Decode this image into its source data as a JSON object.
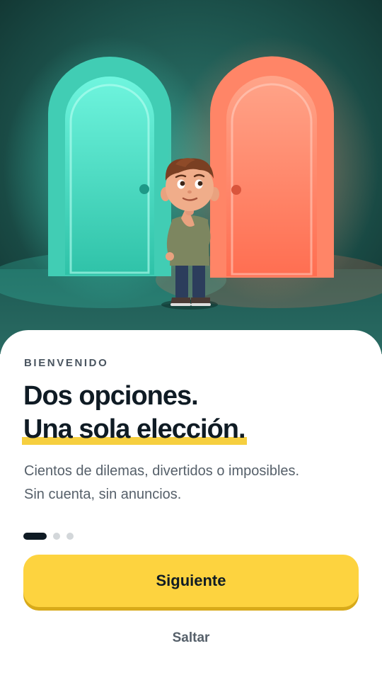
{
  "hero": {
    "illustration": "boy-choosing-between-two-doors",
    "colors": {
      "background": "#1f5a52",
      "left_door": "#3fd6bd",
      "right_door": "#ff7f63"
    }
  },
  "welcome": {
    "eyebrow": "BIENVENIDO",
    "title_line1": "Dos opciones.",
    "title_line2": "Una sola elección.",
    "subtitle_line1": "Cientos de dilemas, divertidos o imposibles.",
    "subtitle_line2": "Sin cuenta, sin anuncios."
  },
  "pagination": {
    "current": 1,
    "total": 3
  },
  "actions": {
    "next_label": "Siguiente",
    "skip_label": "Saltar"
  },
  "colors": {
    "accent": "#fdd33f",
    "text_dark": "#0f1b24",
    "text_muted": "#56606a"
  }
}
